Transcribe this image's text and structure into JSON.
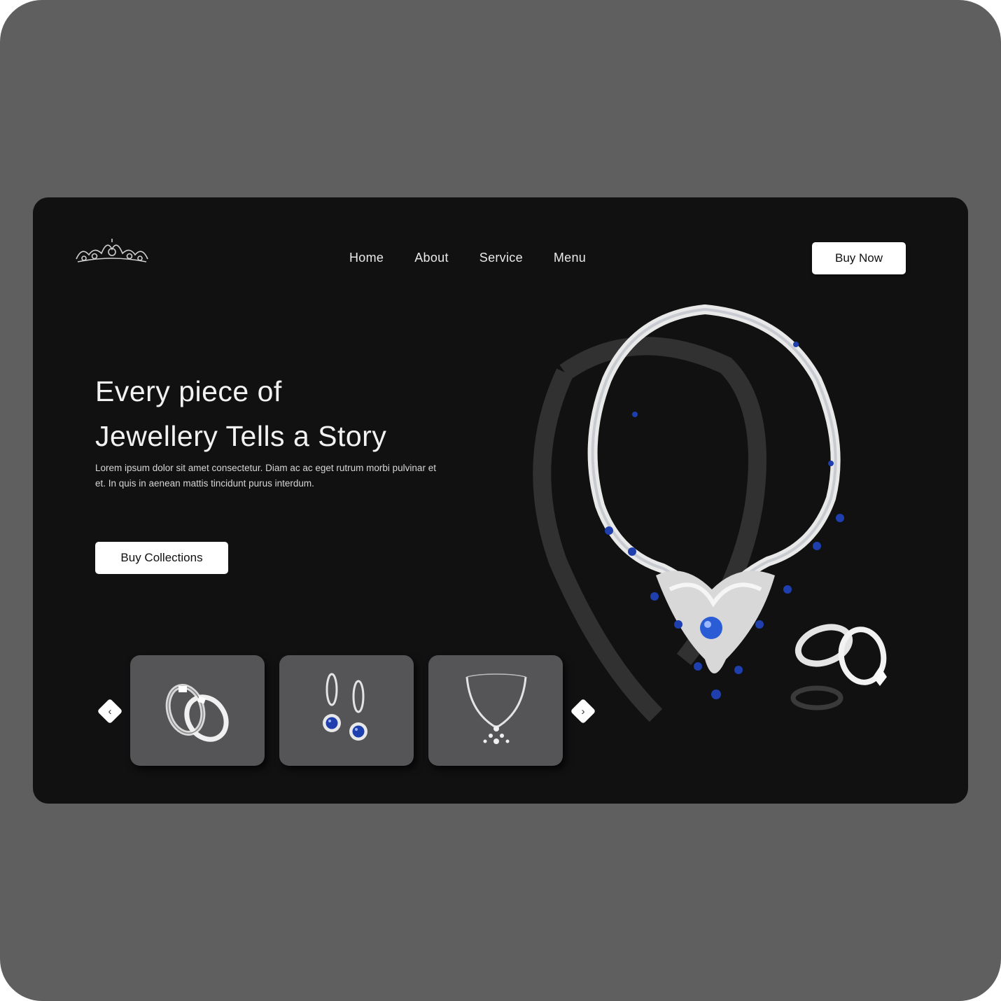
{
  "nav": {
    "items": [
      {
        "label": "Home"
      },
      {
        "label": "About"
      },
      {
        "label": "Service"
      },
      {
        "label": "Menu"
      }
    ],
    "cta_label": "Buy Now"
  },
  "hero": {
    "title_line1": "Every piece of",
    "title_line2": "Jewellery Tells a Story",
    "description": "Lorem ipsum dolor sit amet consectetur. Diam ac ac eget rutrum morbi pulvinar et et. In quis in aenean mattis tincidunt purus interdum.",
    "cta_label": "Buy Collections"
  },
  "carousel": {
    "prev_icon": "chevron-left-icon",
    "next_icon": "chevron-right-icon",
    "prev_glyph": "‹",
    "next_glyph": "›",
    "items": [
      {
        "name": "ring-pair"
      },
      {
        "name": "earrings"
      },
      {
        "name": "necklace"
      }
    ]
  },
  "colors": {
    "outer": "#5f5f5f",
    "screen": "#111112",
    "card": "#555557",
    "sapphire": "#1f3fae"
  }
}
